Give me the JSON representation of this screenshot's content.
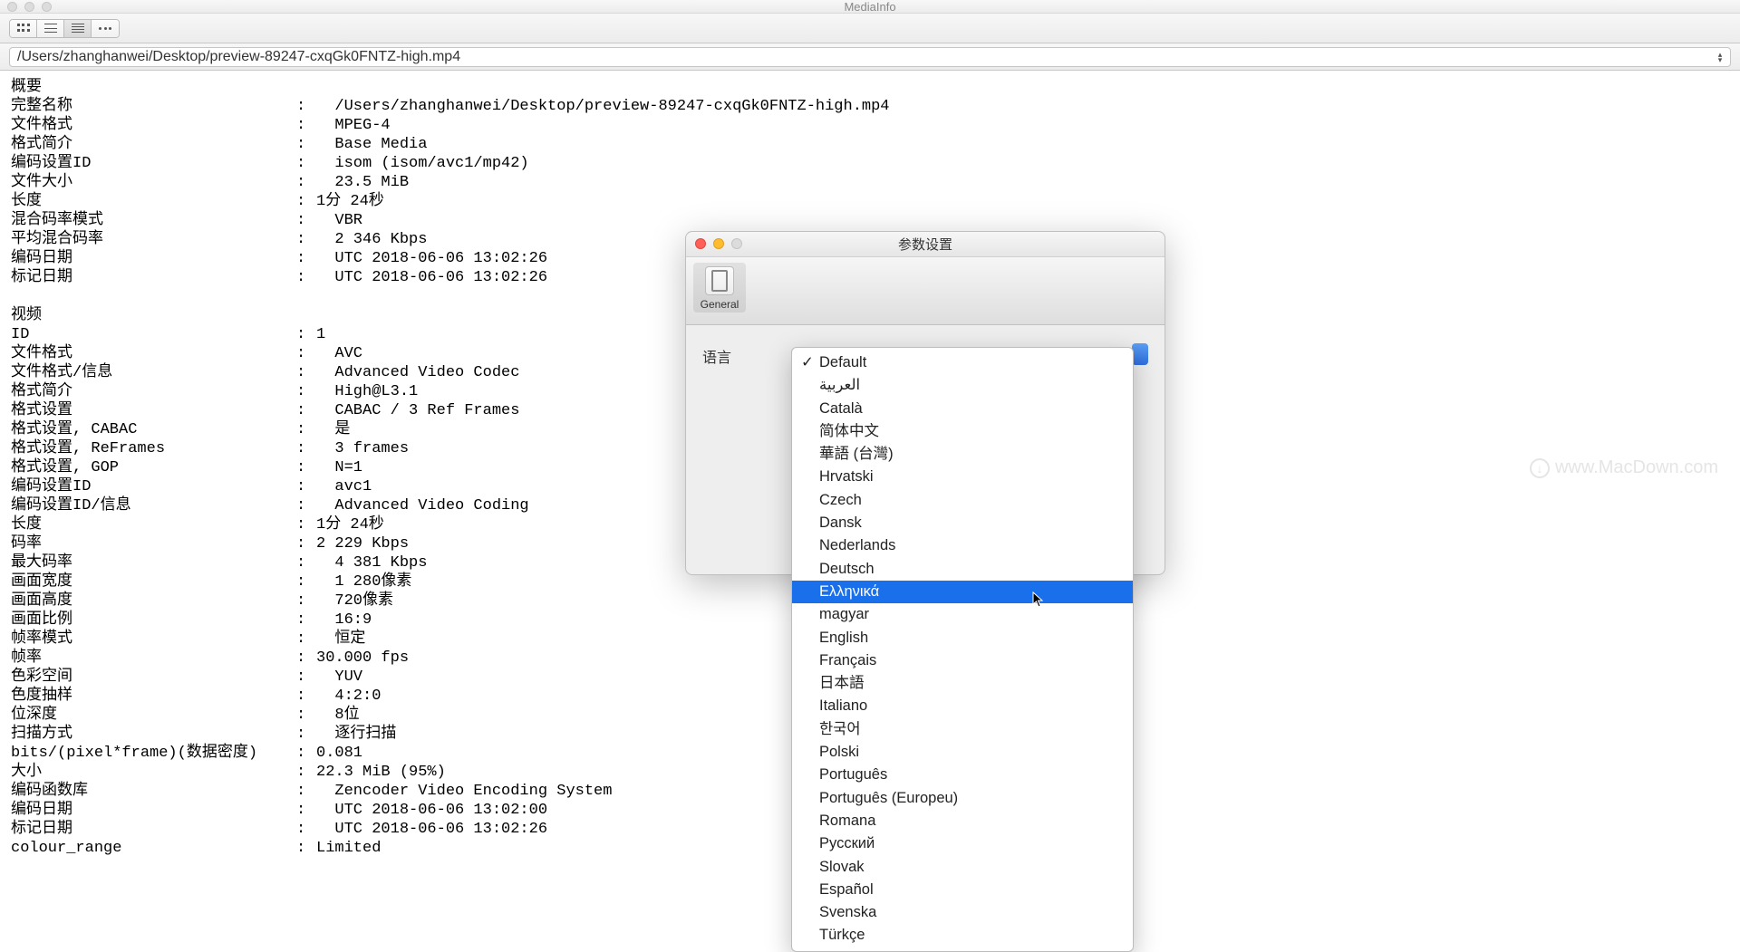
{
  "window_title": "MediaInfo",
  "file_path": "/Users/zhanghanwei/Desktop/preview-89247-cxqGk0FNTZ-high.mp4",
  "watermark": "www.MacDown.com",
  "sections": {
    "general": {
      "header": "概要",
      "rows": [
        {
          "k": "完整名称",
          "v": "/Users/zhanghanwei/Desktop/preview-89247-cxqGk0FNTZ-high.mp4"
        },
        {
          "k": "文件格式",
          "v": "MPEG-4"
        },
        {
          "k": "格式简介",
          "v": "Base Media"
        },
        {
          "k": "编码设置ID",
          "v": "isom (isom/avc1/mp42)"
        },
        {
          "k": "文件大小",
          "v": "23.5 MiB"
        },
        {
          "k": "长度",
          "v": "1分 24秒",
          "tight": true
        },
        {
          "k": "混合码率模式",
          "v": "VBR"
        },
        {
          "k": "平均混合码率",
          "v": "2 346 Kbps"
        },
        {
          "k": "编码日期",
          "v": "UTC 2018-06-06 13:02:26"
        },
        {
          "k": "标记日期",
          "v": "UTC 2018-06-06 13:02:26"
        }
      ]
    },
    "video": {
      "header": "视频",
      "rows": [
        {
          "k": "ID",
          "v": "1",
          "tight": true
        },
        {
          "k": "文件格式",
          "v": "AVC"
        },
        {
          "k": "文件格式/信息",
          "v": "Advanced Video Codec"
        },
        {
          "k": "格式简介",
          "v": "High@L3.1"
        },
        {
          "k": "格式设置",
          "v": "CABAC / 3 Ref Frames"
        },
        {
          "k": "格式设置, CABAC",
          "v": "是"
        },
        {
          "k": "格式设置, ReFrames",
          "v": "3 frames"
        },
        {
          "k": "格式设置, GOP",
          "v": "N=1"
        },
        {
          "k": "编码设置ID",
          "v": "avc1"
        },
        {
          "k": "编码设置ID/信息",
          "v": "Advanced Video Coding"
        },
        {
          "k": "长度",
          "v": "1分 24秒",
          "tight": true
        },
        {
          "k": "码率",
          "v": "2 229 Kbps",
          "tight": true
        },
        {
          "k": "最大码率",
          "v": "4 381 Kbps"
        },
        {
          "k": "画面宽度",
          "v": "1 280像素"
        },
        {
          "k": "画面高度",
          "v": "720像素"
        },
        {
          "k": "画面比例",
          "v": "16:9"
        },
        {
          "k": "帧率模式",
          "v": "恒定"
        },
        {
          "k": "帧率",
          "v": "30.000 fps",
          "tight": true
        },
        {
          "k": "色彩空间",
          "v": "YUV"
        },
        {
          "k": "色度抽样",
          "v": "4:2:0"
        },
        {
          "k": "位深度",
          "v": "8位"
        },
        {
          "k": "扫描方式",
          "v": "逐行扫描"
        },
        {
          "k": "bits/(pixel*frame)(数据密度)",
          "v": "0.081",
          "tight": true
        },
        {
          "k": "大小",
          "v": "22.3 MiB (95%)",
          "tight": true
        },
        {
          "k": "编码函数库",
          "v": "Zencoder Video Encoding System"
        },
        {
          "k": "编码日期",
          "v": "UTC 2018-06-06 13:02:00"
        },
        {
          "k": "标记日期",
          "v": "UTC 2018-06-06 13:02:26"
        },
        {
          "k": "colour_range",
          "v": "Limited",
          "tight": true
        }
      ]
    }
  },
  "prefs": {
    "title": "参数设置",
    "tab_general": "General",
    "lang_label": "语言"
  },
  "dropdown": {
    "checked": "Default",
    "selected": "Ελληνικά",
    "items": [
      "Default",
      "العربية",
      "Català",
      "简体中文",
      "華語 (台灣)",
      "Hrvatski",
      "Czech",
      "Dansk",
      "Nederlands",
      "Deutsch",
      "Ελληνικά",
      "magyar",
      "English",
      "Français",
      "日本語",
      "Italiano",
      "한국어",
      "Polski",
      "Português",
      "Português (Europeu)",
      "Romana",
      "Русский",
      "Slovak",
      "Español",
      "Svenska",
      "Türkçe"
    ]
  }
}
